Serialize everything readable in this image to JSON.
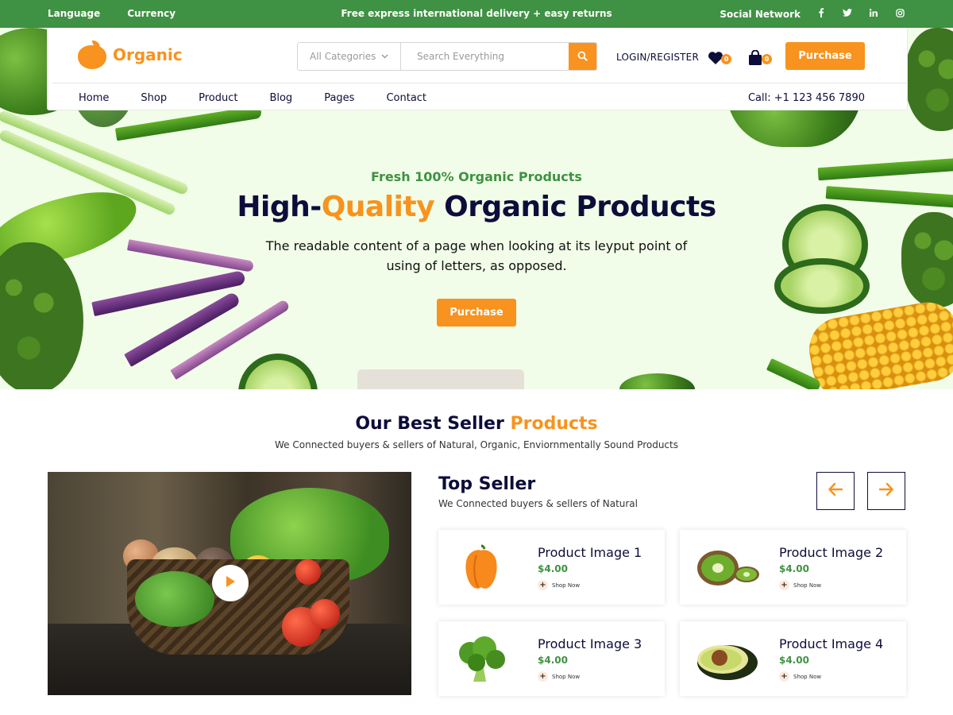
{
  "topbar": {
    "language": "Language",
    "currency": "Currency",
    "promo": "Free express international delivery + easy returns",
    "social_label": "Social Network",
    "social_icons": [
      "facebook-icon",
      "twitter-icon",
      "linkedin-icon",
      "instagram-icon"
    ]
  },
  "header": {
    "logo_text": "Organic",
    "category_select": "All Categories",
    "search_placeholder": "Search Everything",
    "login": "LOGIN/REGISTER",
    "wishlist_count": "0",
    "cart_count": "0",
    "purchase": "Purchase",
    "nav": [
      "Home",
      "Shop",
      "Product",
      "Blog",
      "Pages",
      "Contact"
    ],
    "call": "Call: +1 123 456 7890"
  },
  "hero": {
    "subtitle": "Fresh 100% Organic Products",
    "title_part1": "High-",
    "title_highlight": "Quality",
    "title_part2": " Organic Products",
    "description": "The readable content of a page when looking at its leyput point of using of letters, as opposed.",
    "button": "Purchase"
  },
  "bestseller": {
    "title_part1": "Our Best Seller ",
    "title_highlight": "Products",
    "subtitle": "We Connected buyers & sellers of Natural, Organic, Enviornmentally Sound Products"
  },
  "topseller": {
    "title": "Top Seller",
    "subtitle": "We Connected buyers & sellers of Natural",
    "products": [
      {
        "name": "Product Image 1",
        "price": "$4.00",
        "cta": "Shop Now"
      },
      {
        "name": "Product Image 2",
        "price": "$4.00",
        "cta": "Shop Now"
      },
      {
        "name": "Product Image 3",
        "price": "$4.00",
        "cta": "Shop Now"
      },
      {
        "name": "Product Image 4",
        "price": "$4.00",
        "cta": "Shop Now"
      }
    ]
  },
  "colors": {
    "green": "#3f9143",
    "orange": "#f7931e",
    "navy": "#0d0d3b",
    "hero_bg": "#f1fde8"
  }
}
